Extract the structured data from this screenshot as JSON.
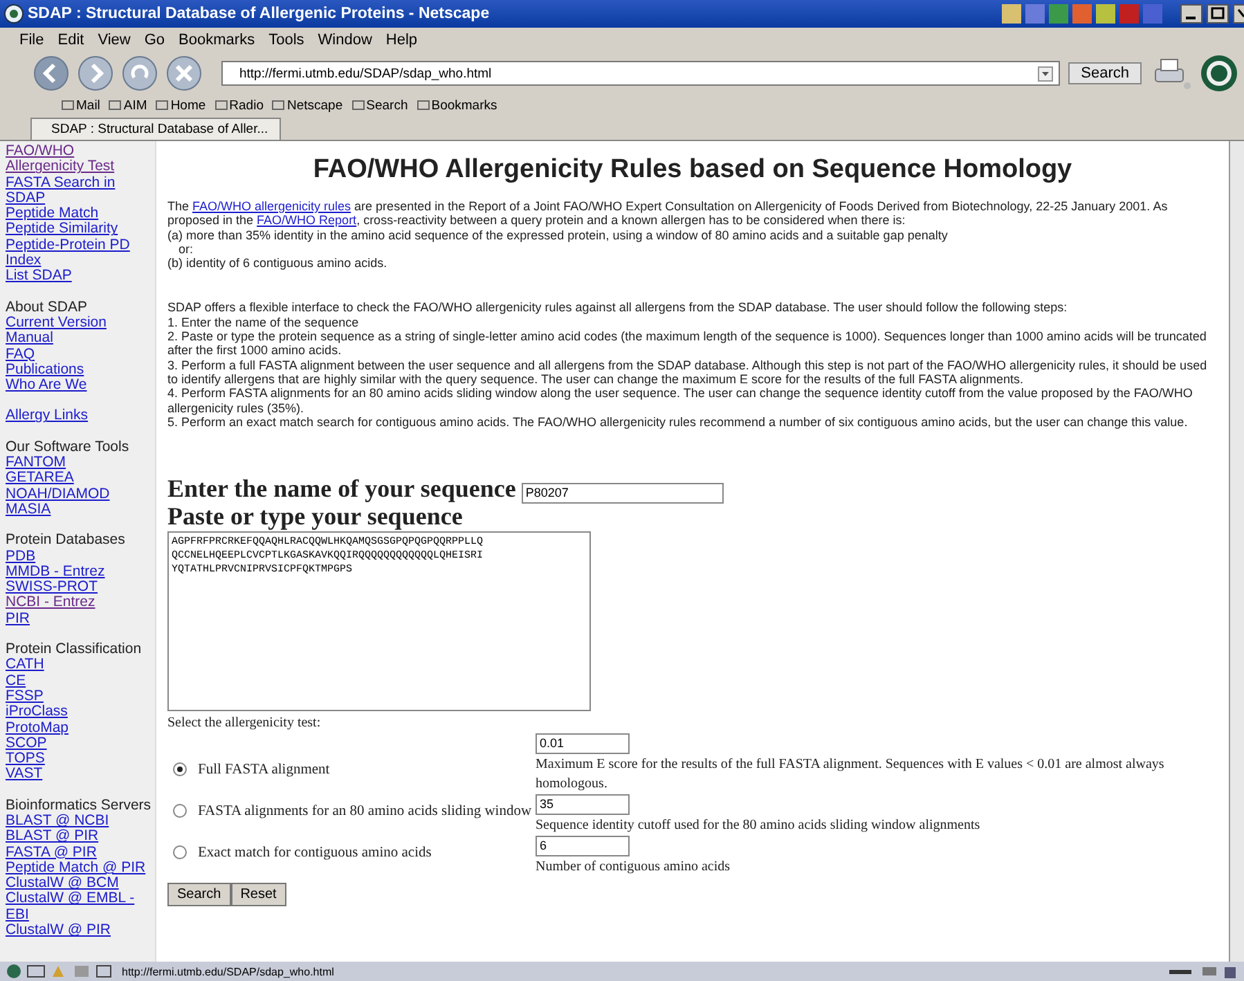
{
  "window": {
    "title": "SDAP : Structural Database of Allergenic Proteins - Netscape"
  },
  "menu": [
    "File",
    "Edit",
    "View",
    "Go",
    "Bookmarks",
    "Tools",
    "Window",
    "Help"
  ],
  "address": {
    "value": "http://fermi.utmb.edu/SDAP/sdap_who.html"
  },
  "search_button": "Search",
  "personal_toolbar": [
    "Mail",
    "AIM",
    "Home",
    "Radio",
    "Netscape",
    "Search",
    "Bookmarks"
  ],
  "tabs": [
    {
      "label": "SDAP : Structural Database of Aller...",
      "selected": true
    }
  ],
  "sidebar": [
    {
      "links": [
        {
          "label": "FAO/WHO Allergenicity Test",
          "visited": true
        },
        {
          "label": "FASTA Search in SDAP",
          "visited": false
        },
        {
          "label": "Peptide Match",
          "visited": false
        },
        {
          "label": "Peptide Similarity",
          "visited": false
        },
        {
          "label": "Peptide-Protein PD",
          "visited": false
        },
        {
          "label": "Index",
          "visited": false
        },
        {
          "label": "List SDAP",
          "visited": false
        }
      ]
    },
    {
      "heading": "About SDAP",
      "links": [
        {
          "label": "Current Version",
          "visited": false
        },
        {
          "label": "Manual",
          "visited": false
        },
        {
          "label": "FAQ",
          "visited": false
        },
        {
          "label": "Publications",
          "visited": false
        },
        {
          "label": "Who Are We",
          "visited": false
        }
      ]
    },
    {
      "links": [
        {
          "label": "Allergy Links",
          "visited": false
        }
      ]
    },
    {
      "heading": "Our Software Tools",
      "links": [
        {
          "label": "FANTOM",
          "visited": false
        },
        {
          "label": "GETAREA",
          "visited": false
        },
        {
          "label": "NOAH/DIAMOD",
          "visited": false
        },
        {
          "label": "MASIA",
          "visited": false
        }
      ]
    },
    {
      "heading": "Protein Databases",
      "links": [
        {
          "label": "PDB",
          "visited": false
        },
        {
          "label": "MMDB - Entrez",
          "visited": false
        },
        {
          "label": "SWISS-PROT",
          "visited": false
        },
        {
          "label": "NCBI - Entrez",
          "visited": true
        },
        {
          "label": "PIR",
          "visited": false
        }
      ]
    },
    {
      "heading": "Protein Classification",
      "links": [
        {
          "label": "CATH",
          "visited": false
        },
        {
          "label": "CE",
          "visited": false
        },
        {
          "label": "FSSP",
          "visited": false
        },
        {
          "label": "iProClass",
          "visited": false
        },
        {
          "label": "ProtoMap",
          "visited": false
        },
        {
          "label": "SCOP",
          "visited": false
        },
        {
          "label": "TOPS",
          "visited": false
        },
        {
          "label": "VAST",
          "visited": false
        }
      ]
    },
    {
      "heading": "Bioinformatics Servers",
      "links": [
        {
          "label": "BLAST @ NCBI",
          "visited": false
        },
        {
          "label": "BLAST @ PIR",
          "visited": false
        },
        {
          "label": "FASTA @ PIR",
          "visited": false
        },
        {
          "label": "Peptide Match @ PIR",
          "visited": false
        },
        {
          "label": "ClustalW @ BCM",
          "visited": false
        },
        {
          "label": "ClustalW @ EMBL - EBI",
          "visited": false
        },
        {
          "label": "ClustalW @ PIR",
          "visited": false
        }
      ]
    }
  ],
  "page_title": "FAO/WHO Allergenicity Rules based on Sequence Homology",
  "intro": [
    {
      "kind": "text",
      "text": "The "
    },
    {
      "kind": "link",
      "text": "FAO/WHO allergenicity rules"
    },
    {
      "kind": "text",
      "text": " are presented in the Report of a Joint FAO/WHO Expert Consultation on Allergenicity of Foods Derived from Biotechnology, 22-25 January 2001. As proposed in the "
    },
    {
      "kind": "link",
      "text": "FAO/WHO Report"
    },
    {
      "kind": "text",
      "text": ", cross-reactivity between a query protein and a known allergen has to be considered when there is:"
    }
  ],
  "criteria": [
    "(a) more than 35% identity in the amino acid sequence of the expressed protein, using a window of 80 amino acids and a suitable gap penalty",
    "or:",
    "(b) identity of 6 contiguous amino acids."
  ],
  "steps_intro": "SDAP offers a flexible interface to check the FAO/WHO allergenicity rules against all allergens from the SDAP database. The user should follow the following steps:",
  "steps": [
    "1. Enter the name of the sequence",
    "2. Paste or type the protein sequence as a string of single-letter amino acid codes (the maximum length of the sequence is 1000). Sequences longer than 1000 amino acids will be truncated after the first 1000 amino acids.",
    "3. Perform a full FASTA alignment between the user sequence and all allergens from the SDAP database. Although this step is not part of the FAO/WHO allergenicity rules, it should be used to identify allergens that are highly similar with the query sequence. The user can change the maximum E score for the results of the full FASTA alignments.",
    "4. Perform FASTA alignments for an 80 amino acids sliding window along the user sequence. The user can change the sequence identity cutoff from the value proposed by the FAO/WHO allergenicity rules (35%).",
    "5. Perform an exact match search for contiguous amino acids. The FAO/WHO allergenicity rules recommend a number of six contiguous amino acids, but the user can change this value."
  ],
  "name_label": "Enter the name of your sequence",
  "name_value": "P80207",
  "sequence_label": "Paste or type your sequence",
  "sequence_value": "AGPFRFPRCRKEFQQAQHLRACQQWLHKQAMQSGSGPQPQGPQQRPPLLQ\nQCCNELHQEEPLCVCPTLKGASKAVKQQIRQQQQQQQQQQQQLQHEISRI\nYQTATHLPRVCNIPRVSICPFQKTMPGPS",
  "test_label": "Select the allergenicity test:",
  "tests": [
    {
      "label": "Full FASTA alignment",
      "selected": true,
      "value": "0.01",
      "description": "Maximum E score for the results of the full FASTA alignment. Sequences with E values < 0.01 are almost always homologous."
    },
    {
      "label": "FASTA alignments for an 80 amino acids sliding window",
      "selected": false,
      "value": "35",
      "description": "Sequence identity cutoff used for the 80 amino acids sliding window alignments"
    },
    {
      "label": "Exact match for contiguous amino acids",
      "selected": false,
      "value": "6",
      "description": "Number of contiguous amino acids"
    }
  ],
  "buttons": [
    "Search",
    "Reset"
  ],
  "status_bar": "http://fermi.utmb.edu/SDAP/sdap_who.html"
}
